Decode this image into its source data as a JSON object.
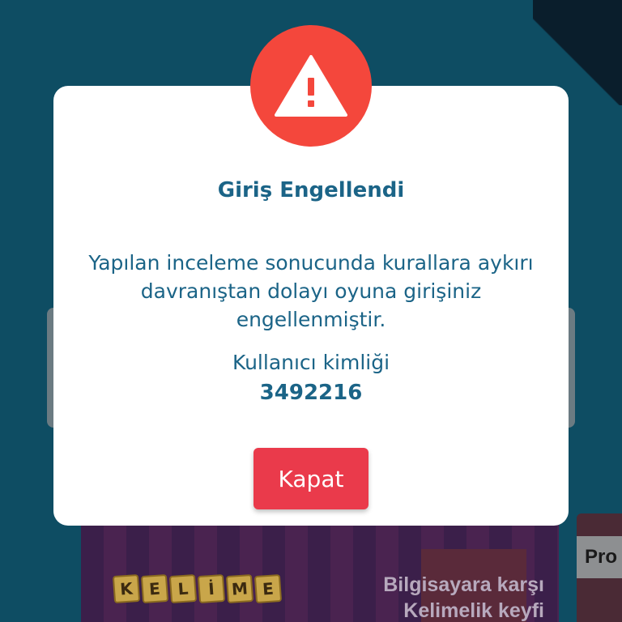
{
  "background": {
    "banner": {
      "logo_letters": [
        "K",
        "E",
        "L",
        "İ",
        "M",
        "E"
      ],
      "headline_line1": "Bilgisayara karşı",
      "headline_line2": "Kelimelik keyfi"
    },
    "side_card_label": "Pro"
  },
  "dialog": {
    "icon": "warning-triangle-icon",
    "title": "Giriş Engellendi",
    "message": "Yapılan inceleme sonucunda kurallara aykırı davranıştan dolayı oyuna girişiniz engellenmiştir.",
    "user_id_label": "Kullanıcı kimliği",
    "user_id_value": "3492216",
    "close_label": "Kapat"
  },
  "colors": {
    "page_background": "#0e4d63",
    "dialog_text": "#1b6487",
    "alert_red": "#f4473c",
    "button_red": "#ea3a4b"
  }
}
